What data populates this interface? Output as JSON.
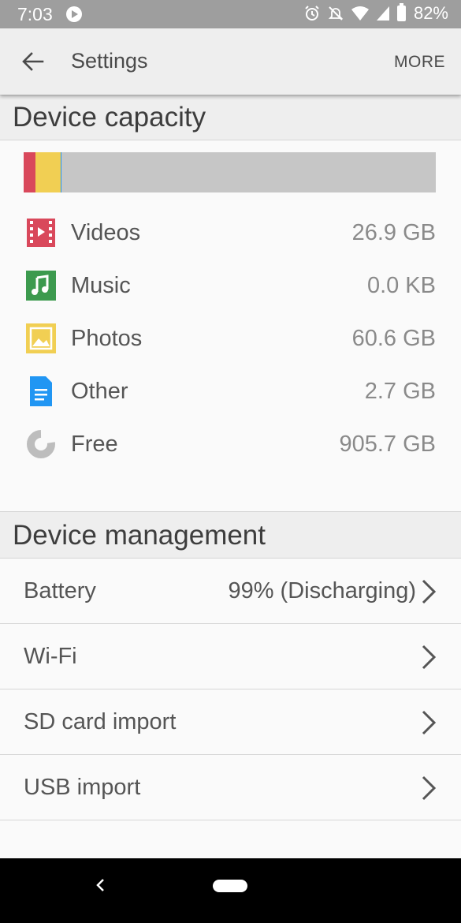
{
  "status_bar": {
    "time": "7:03",
    "battery": "82%"
  },
  "app_bar": {
    "title": "Settings",
    "more_label": "MORE"
  },
  "capacity": {
    "header": "Device capacity",
    "segments": [
      {
        "name": "Videos",
        "color": "#d9485b",
        "fraction": 0.028
      },
      {
        "name": "Music",
        "color": "#3c9a4e",
        "fraction": 0.0
      },
      {
        "name": "Photos",
        "color": "#f1cf53",
        "fraction": 0.061
      },
      {
        "name": "Other",
        "color": "#2196f3",
        "fraction": 0.003
      },
      {
        "name": "Free",
        "color": "#c6c6c6",
        "fraction": 0.908
      }
    ],
    "items": [
      {
        "label": "Videos",
        "value": "26.9 GB",
        "icon": "video-icon",
        "color": "#d9485b"
      },
      {
        "label": "Music",
        "value": "0.0 KB",
        "icon": "music-icon",
        "color": "#3c9a4e"
      },
      {
        "label": "Photos",
        "value": "60.6 GB",
        "icon": "photo-icon",
        "color": "#f1cf53"
      },
      {
        "label": "Other",
        "value": "2.7 GB",
        "icon": "document-icon",
        "color": "#2196f3"
      },
      {
        "label": "Free",
        "value": "905.7 GB",
        "icon": "pie-icon",
        "color": "#bdbdbd"
      }
    ]
  },
  "management": {
    "header": "Device management",
    "items": [
      {
        "label": "Battery",
        "value": "99% (Discharging)"
      },
      {
        "label": "Wi-Fi",
        "value": ""
      },
      {
        "label": "SD card import",
        "value": ""
      },
      {
        "label": "USB import",
        "value": ""
      }
    ]
  }
}
